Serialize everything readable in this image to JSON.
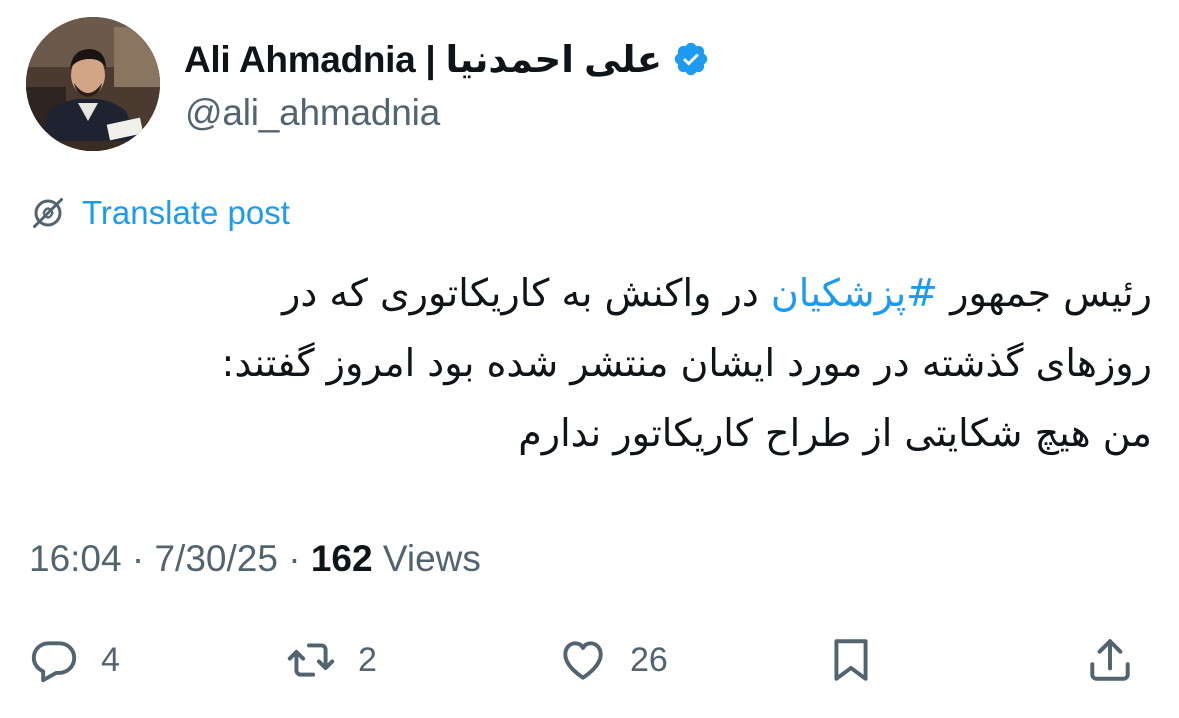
{
  "author": {
    "display_name": "Ali Ahmadnia | علی احمدنیا",
    "handle": "@ali_ahmadnia",
    "verified": true
  },
  "translate_label": "Translate post",
  "post": {
    "line1_before": "رئیس جمهور ",
    "hashtag": "#پزشکیان",
    "line1_after": " در واکنش به کاریکاتوری که در",
    "line2": "روزهای گذشته در مورد ایشان منتشر شده بود امروز گفتند:",
    "line3": "من هیچ شکایتی از طراح کاریکاتور ندارم"
  },
  "meta": {
    "time": "16:04",
    "date": "7/30/25",
    "separator": "·",
    "views_count": "162",
    "views_label": "Views"
  },
  "actions": {
    "reply_count": "4",
    "retweet_count": "2",
    "like_count": "26"
  },
  "icons": {
    "verified": "verified-badge-icon",
    "translate": "globe-icon",
    "reply": "reply-icon",
    "retweet": "retweet-icon",
    "like": "heart-icon",
    "bookmark": "bookmark-icon",
    "share": "share-icon"
  },
  "colors": {
    "accent": "#1d9bf0",
    "text": "#0f1419",
    "secondary": "#536471"
  }
}
